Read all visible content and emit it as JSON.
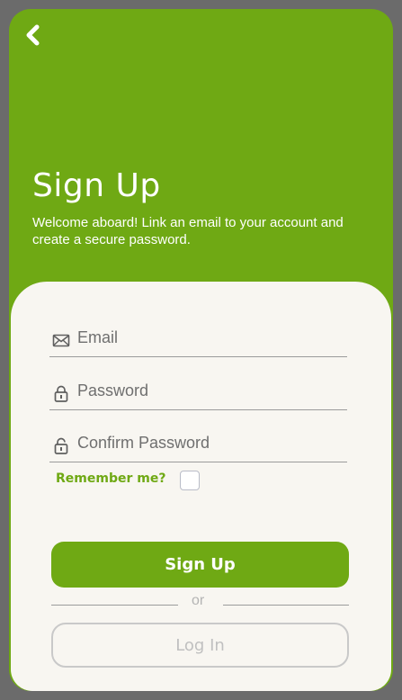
{
  "header": {
    "back_icon": "chevron-left-icon",
    "title": "Sign Up",
    "subtitle": "Welcome aboard! Link an email to your account and create a secure password."
  },
  "form": {
    "email": {
      "placeholder": "Email",
      "value": "",
      "icon": "envelope-icon"
    },
    "password": {
      "placeholder": "Password",
      "value": "",
      "icon": "lock-icon"
    },
    "confirm_password": {
      "placeholder": "Confirm Password",
      "value": "",
      "icon": "lock-icon"
    },
    "remember_label": "Remember me?",
    "remember_checked": false
  },
  "actions": {
    "signup_label": "Sign Up",
    "divider_text": "or",
    "login_label": "Log In"
  },
  "colors": {
    "accent": "#6fa914",
    "card_background": "#f8f6f1",
    "outer_background": "#6b6b6b"
  }
}
